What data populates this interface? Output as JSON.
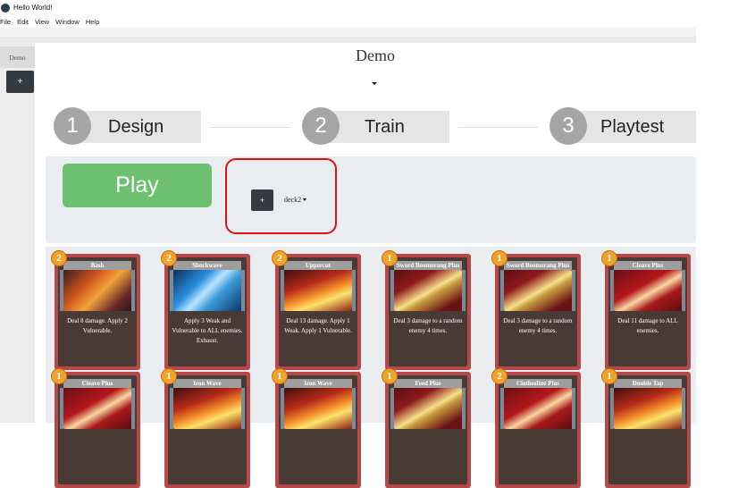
{
  "window": {
    "title": "Hello World!"
  },
  "menu": [
    "File",
    "Edit",
    "View",
    "Window",
    "Help"
  ],
  "sidebar": {
    "tab_label": "Demo",
    "add_label": "+"
  },
  "header": {
    "title": "Demo"
  },
  "steps": [
    {
      "number": "1",
      "label": "Design"
    },
    {
      "number": "2",
      "label": "Train"
    },
    {
      "number": "3",
      "label": "Playtest"
    }
  ],
  "play": {
    "label": "Play"
  },
  "deck": {
    "add_label": "+",
    "selected": "deck2"
  },
  "cards": [
    {
      "cost": "2",
      "name": "Bash",
      "text": "Deal 8 damage. Apply 2 Vulnerable.",
      "art": "art-attack"
    },
    {
      "cost": "2",
      "name": "Shockwave",
      "text": "Apply 3 Weak and Vulnerable to ALL enemies. Exhaust.",
      "art": "art-blue"
    },
    {
      "cost": "2",
      "name": "Uppercut",
      "text": "Deal 13 damage. Apply 1 Weak. Apply 1 Vulnerable.",
      "art": "art-fire"
    },
    {
      "cost": "1",
      "name": "Sword Boomerang Plus",
      "text": "Deal 3 damage to a random enemy 4 times.",
      "art": "art-boom"
    },
    {
      "cost": "1",
      "name": "Sword Boomerang Plus",
      "text": "Deal 3 damage to a random enemy 4 times.",
      "art": "art-boom"
    },
    {
      "cost": "1",
      "name": "Cleave Plus",
      "text": "Deal 11 damage to ALL enemies.",
      "art": "art-cleave"
    },
    {
      "cost": "1",
      "name": "Cleave Plus",
      "text": "",
      "art": "art-cleave"
    },
    {
      "cost": "1",
      "name": "Iron Wave",
      "text": "",
      "art": "art-fire"
    },
    {
      "cost": "1",
      "name": "Iron Wave",
      "text": "",
      "art": "art-fire"
    },
    {
      "cost": "1",
      "name": "Feed Plus",
      "text": "",
      "art": "art-boom"
    },
    {
      "cost": "2",
      "name": "Clothesline Plus",
      "text": "",
      "art": "art-cleave"
    },
    {
      "cost": "1",
      "name": "Double Tap",
      "text": "",
      "art": "art-fire"
    }
  ]
}
